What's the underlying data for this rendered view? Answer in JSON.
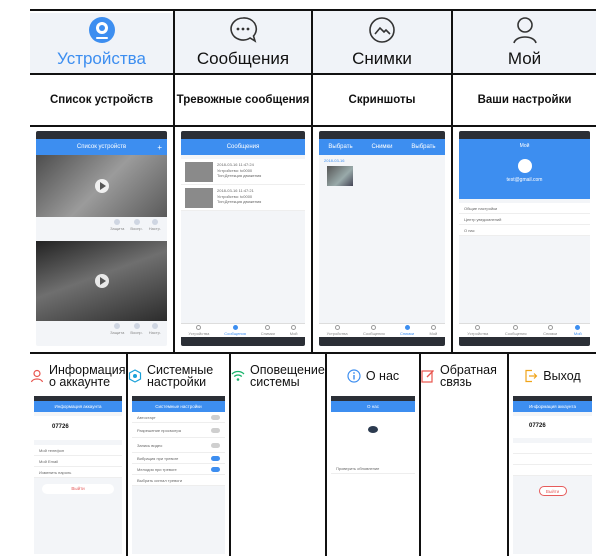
{
  "tabs": [
    {
      "label": "Устройства",
      "icon": "camera-icon",
      "active": true
    },
    {
      "label": "Сообщения",
      "icon": "chat-bubble-icon",
      "active": false
    },
    {
      "label": "Снимки",
      "icon": "photo-icon",
      "active": false
    },
    {
      "label": "Мой",
      "icon": "user-icon",
      "active": false
    }
  ],
  "descriptions": [
    "Список устройств",
    "Тревожные сообщения",
    "Скриншоты",
    "Ваши настройки"
  ],
  "screens": {
    "devices": {
      "title": "Список устройств",
      "controls": [
        "Защита",
        "Воспр.",
        "Настр."
      ]
    },
    "messages": {
      "title": "Сообщения",
      "items": [
        {
          "time": "2018-03-16 11:47:24",
          "device": "Устройство: tc0000",
          "type": "Тип:Детекция движения"
        },
        {
          "time": "2018-03-16 11:47:21",
          "device": "Устройство: tc0000",
          "type": "Тип:Детекция движения"
        }
      ]
    },
    "snapshots": {
      "tabs": [
        "Выбрать",
        "Снимки",
        "Выбрать"
      ],
      "date": "2018-03-16"
    },
    "profile": {
      "title": "Мой",
      "email": "test@gmail.com",
      "menu": [
        "Общие настройки",
        "Центр уведомлений",
        "О нас"
      ]
    },
    "bottom_tabs": [
      "Устройства",
      "Сообщения",
      "Снимки",
      "Мой"
    ]
  },
  "bottom_sections": [
    {
      "label": "Информация о аккаунте",
      "icon": "user-outline-icon",
      "color": "#e8554e"
    },
    {
      "label": "Системные настройки",
      "icon": "settings-hex-icon",
      "color": "#1aa0d8"
    },
    {
      "label": "Оповещение системы",
      "icon": "wifi-icon",
      "color": "#19b36b"
    },
    {
      "label": "О нас",
      "icon": "info-icon",
      "color": "#3d8ef0"
    },
    {
      "label": "Обратная связь",
      "icon": "edit-icon",
      "color": "#e8554e"
    },
    {
      "label": "Выход",
      "icon": "logout-icon",
      "color": "#f0a41a"
    }
  ],
  "account": {
    "title": "Информация аккаунта",
    "user": "07726",
    "rows": [
      "Мой телефон",
      "Мой Email",
      "Изменить пароль"
    ],
    "logout": "Выйти"
  },
  "system": {
    "title": "Системные настройки",
    "rows": [
      "Автостарт",
      "Разрешение просмотра",
      "Запись видео",
      "Вибрация при тревоге",
      "Мелодия при тревоге",
      "Выбрать сигнал тревоги"
    ]
  },
  "about": {
    "title": "О нас",
    "check": "Проверить обновление"
  },
  "logout": {
    "title": "Информация аккаунта",
    "user": "07726",
    "logout": "Выйти"
  }
}
